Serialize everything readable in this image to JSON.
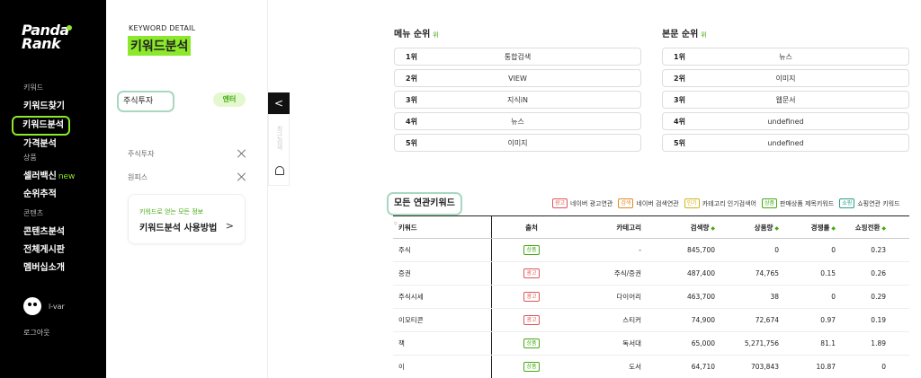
{
  "brand": {
    "logo_line1": "Panda",
    "logo_line2": "Rank"
  },
  "sidebar": {
    "cat_keyword": "키워드",
    "item_find": "키워드찾기",
    "item_analysis": "키워드분석",
    "item_price": "가격분석",
    "cat_product": "상품",
    "item_seller": "셀러백신",
    "new_badge": "new",
    "item_rank": "순위추적",
    "cat_content": "콘텐츠",
    "item_content_analysis": "콘텐츠분석",
    "item_board": "전체게시판",
    "item_member": "멤버십소개",
    "user_name": "l-var",
    "logout": "로그아웃"
  },
  "panel": {
    "label": "KEYWORD DETAIL",
    "title": "키워드분석",
    "search_value": "주식투자",
    "enter": "엔터",
    "keywords": [
      "주식투자",
      "원피스"
    ],
    "card_sub": "키워드로 얻는 모든 정보",
    "card_title": "키워드분석 사용방법",
    "card_arrow": ">",
    "toggle_arrow": "<",
    "vertical_text": "최근검색"
  },
  "menu_rank": {
    "title": "메뉴 순위",
    "unit": "위",
    "rows": [
      {
        "rank": "1위",
        "value": "통합검색"
      },
      {
        "rank": "2위",
        "value": "VIEW"
      },
      {
        "rank": "3위",
        "value": "지식iN"
      },
      {
        "rank": "4위",
        "value": "뉴스"
      },
      {
        "rank": "5위",
        "value": "이미지"
      }
    ]
  },
  "body_rank": {
    "title": "본문 순위",
    "unit": "위",
    "rows": [
      {
        "rank": "1위",
        "value": "뉴스"
      },
      {
        "rank": "2위",
        "value": "이미지"
      },
      {
        "rank": "3위",
        "value": "웹문서"
      },
      {
        "rank": "4위",
        "value": "undefined"
      },
      {
        "rank": "5위",
        "value": "undefined"
      }
    ]
  },
  "related": {
    "title": "모든 연관키워드",
    "dropdown": "▿",
    "legend": [
      {
        "tag": "광고",
        "label": "네이버 광고연관",
        "color": "#e05555"
      },
      {
        "tag": "검색",
        "label": "네이버 검색연관",
        "color": "#e08a2a"
      },
      {
        "tag": "인기",
        "label": "카테고리 인기검색어",
        "color": "#d4b21a"
      },
      {
        "tag": "상품",
        "label": "판매상품 제목키워드",
        "color": "#44aa11"
      },
      {
        "tag": "쇼핑",
        "label": "쇼핑연관 키워드",
        "color": "#2aa08a"
      }
    ],
    "headers": {
      "keyword": "키워드",
      "source": "출처",
      "category": "카테고리",
      "search": "검색량",
      "products": "상품량",
      "competition": "경쟁률",
      "conversion": "쇼핑전환",
      "sort_mark": "◆"
    },
    "rows": [
      {
        "keyword": "주식",
        "source": "상품",
        "source_color": "#44aa11",
        "category": "-",
        "search": "845,700",
        "products": "0",
        "competition": "0",
        "conversion": "0.23"
      },
      {
        "keyword": "증권",
        "source": "광고",
        "source_color": "#e05555",
        "category": "주식/증권",
        "search": "487,400",
        "products": "74,765",
        "competition": "0.15",
        "conversion": "0.26"
      },
      {
        "keyword": "주식시세",
        "source": "광고",
        "source_color": "#e05555",
        "category": "다이어리",
        "search": "463,700",
        "products": "38",
        "competition": "0",
        "conversion": "0.29"
      },
      {
        "keyword": "이모티콘",
        "source": "광고",
        "source_color": "#e05555",
        "category": "스티커",
        "search": "74,900",
        "products": "72,674",
        "competition": "0.97",
        "conversion": "0.19"
      },
      {
        "keyword": "책",
        "source": "상품",
        "source_color": "#44aa11",
        "category": "독서대",
        "search": "65,000",
        "products": "5,271,756",
        "competition": "81.1",
        "conversion": "1.89"
      },
      {
        "keyword": "이",
        "source": "상품",
        "source_color": "#44aa11",
        "category": "도서",
        "search": "64,710",
        "products": "703,843",
        "competition": "10.87",
        "conversion": "0"
      }
    ]
  }
}
